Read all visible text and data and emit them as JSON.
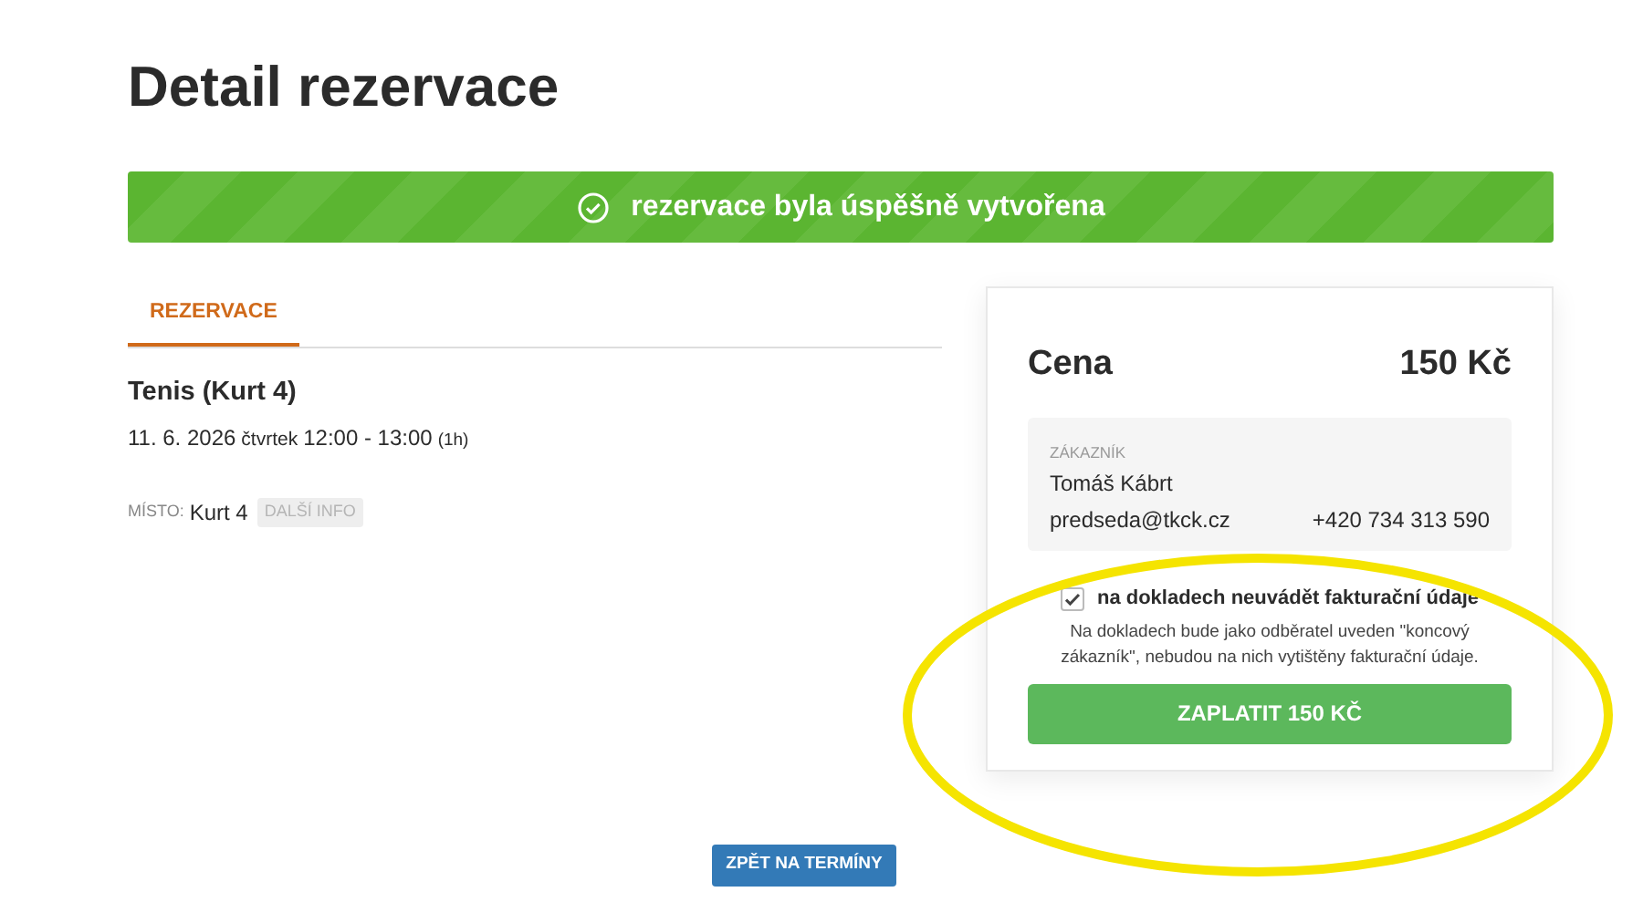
{
  "title": "Detail rezervace",
  "banner": {
    "text": "rezervace byla úspěšně vytvořena"
  },
  "tabs": [
    {
      "label": "REZERVACE",
      "selected": true
    }
  ],
  "reservation": {
    "name": "Tenis (Kurt 4)",
    "date": "11. 6. 2026",
    "weekday": "čtvrtek",
    "time": "12:00 - 13:00",
    "duration": "(1h)",
    "place_label": "MÍSTO:",
    "place": "Kurt 4",
    "info_button": "DALŠÍ INFO"
  },
  "price": {
    "label": "Cena",
    "value": "150 Kč"
  },
  "customer": {
    "label": "ZÁKAZNÍK",
    "name": "Tomáš Kábrt",
    "email": "predseda@tkck.cz",
    "phone": "+420 734 313 590"
  },
  "invoice_option": {
    "label": "na dokladech neuvádět fakturační údaje",
    "checked": true,
    "note": "Na dokladech bude jako odběratel uveden \"koncový zákazník\", nebudou na nich vytištěny fakturační údaje."
  },
  "pay_button": "ZAPLATIT 150 KČ",
  "back_button": "ZPĚT NA TERMÍNY",
  "highlight": {
    "shown": true
  }
}
